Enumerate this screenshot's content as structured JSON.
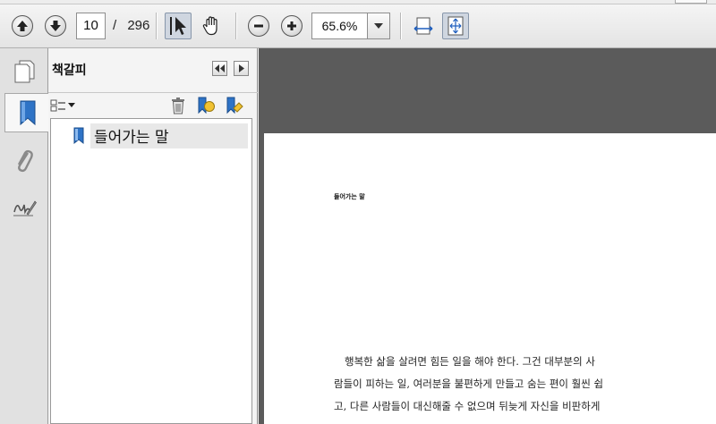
{
  "toolbar": {
    "page_current": "10",
    "page_separator": "/",
    "page_total": "296",
    "zoom_value": "65.6%"
  },
  "rail": {
    "items": [
      "pages-icon",
      "bookmark-icon",
      "paperclip-icon",
      "signature-icon"
    ]
  },
  "panel": {
    "title": "책갈피",
    "bookmarks": [
      {
        "label": "들어가는 말"
      }
    ]
  },
  "document": {
    "heading": "들어가는 말",
    "lines": [
      "행복한 삶을 살려면 힘든 일을 해야 한다. 그건 대부분의 사",
      "람들이 피하는 일, 여러분을 불편하게 만들고 숨는 편이 훨씬 쉽",
      "고, 다른 사람들이 대신해줄 수 없으며 뒤늦게 자신을 비판하게"
    ]
  },
  "colors": {
    "doc_background": "#5b5b5b",
    "panel_background": "#f4f4f4",
    "selection": "#e8e8e8"
  }
}
